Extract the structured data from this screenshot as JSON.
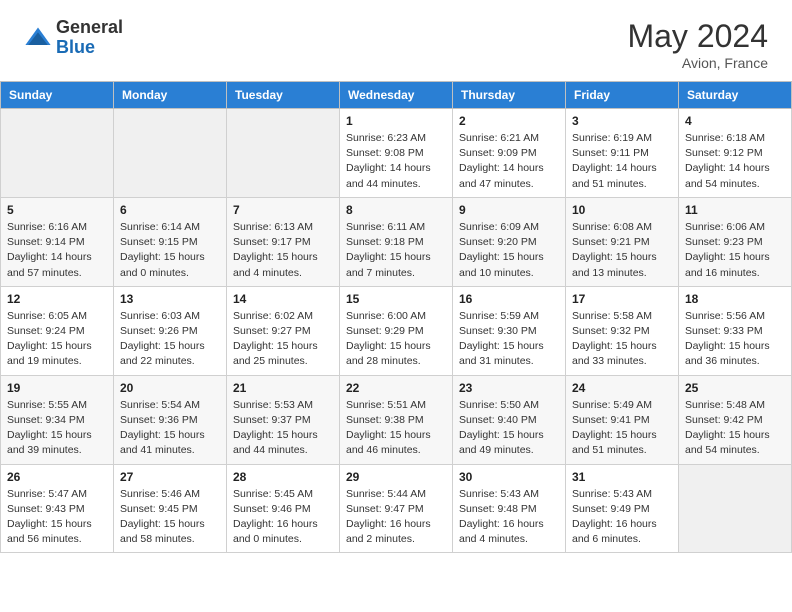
{
  "header": {
    "logo_general": "General",
    "logo_blue": "Blue",
    "month_year": "May 2024",
    "location": "Avion, France"
  },
  "days_of_week": [
    "Sunday",
    "Monday",
    "Tuesday",
    "Wednesday",
    "Thursday",
    "Friday",
    "Saturday"
  ],
  "weeks": [
    [
      {
        "day": "",
        "empty": true
      },
      {
        "day": "",
        "empty": true
      },
      {
        "day": "",
        "empty": true
      },
      {
        "day": "1",
        "sunrise": "Sunrise: 6:23 AM",
        "sunset": "Sunset: 9:08 PM",
        "daylight": "Daylight: 14 hours and 44 minutes."
      },
      {
        "day": "2",
        "sunrise": "Sunrise: 6:21 AM",
        "sunset": "Sunset: 9:09 PM",
        "daylight": "Daylight: 14 hours and 47 minutes."
      },
      {
        "day": "3",
        "sunrise": "Sunrise: 6:19 AM",
        "sunset": "Sunset: 9:11 PM",
        "daylight": "Daylight: 14 hours and 51 minutes."
      },
      {
        "day": "4",
        "sunrise": "Sunrise: 6:18 AM",
        "sunset": "Sunset: 9:12 PM",
        "daylight": "Daylight: 14 hours and 54 minutes."
      }
    ],
    [
      {
        "day": "5",
        "sunrise": "Sunrise: 6:16 AM",
        "sunset": "Sunset: 9:14 PM",
        "daylight": "Daylight: 14 hours and 57 minutes."
      },
      {
        "day": "6",
        "sunrise": "Sunrise: 6:14 AM",
        "sunset": "Sunset: 9:15 PM",
        "daylight": "Daylight: 15 hours and 0 minutes."
      },
      {
        "day": "7",
        "sunrise": "Sunrise: 6:13 AM",
        "sunset": "Sunset: 9:17 PM",
        "daylight": "Daylight: 15 hours and 4 minutes."
      },
      {
        "day": "8",
        "sunrise": "Sunrise: 6:11 AM",
        "sunset": "Sunset: 9:18 PM",
        "daylight": "Daylight: 15 hours and 7 minutes."
      },
      {
        "day": "9",
        "sunrise": "Sunrise: 6:09 AM",
        "sunset": "Sunset: 9:20 PM",
        "daylight": "Daylight: 15 hours and 10 minutes."
      },
      {
        "day": "10",
        "sunrise": "Sunrise: 6:08 AM",
        "sunset": "Sunset: 9:21 PM",
        "daylight": "Daylight: 15 hours and 13 minutes."
      },
      {
        "day": "11",
        "sunrise": "Sunrise: 6:06 AM",
        "sunset": "Sunset: 9:23 PM",
        "daylight": "Daylight: 15 hours and 16 minutes."
      }
    ],
    [
      {
        "day": "12",
        "sunrise": "Sunrise: 6:05 AM",
        "sunset": "Sunset: 9:24 PM",
        "daylight": "Daylight: 15 hours and 19 minutes."
      },
      {
        "day": "13",
        "sunrise": "Sunrise: 6:03 AM",
        "sunset": "Sunset: 9:26 PM",
        "daylight": "Daylight: 15 hours and 22 minutes."
      },
      {
        "day": "14",
        "sunrise": "Sunrise: 6:02 AM",
        "sunset": "Sunset: 9:27 PM",
        "daylight": "Daylight: 15 hours and 25 minutes."
      },
      {
        "day": "15",
        "sunrise": "Sunrise: 6:00 AM",
        "sunset": "Sunset: 9:29 PM",
        "daylight": "Daylight: 15 hours and 28 minutes."
      },
      {
        "day": "16",
        "sunrise": "Sunrise: 5:59 AM",
        "sunset": "Sunset: 9:30 PM",
        "daylight": "Daylight: 15 hours and 31 minutes."
      },
      {
        "day": "17",
        "sunrise": "Sunrise: 5:58 AM",
        "sunset": "Sunset: 9:32 PM",
        "daylight": "Daylight: 15 hours and 33 minutes."
      },
      {
        "day": "18",
        "sunrise": "Sunrise: 5:56 AM",
        "sunset": "Sunset: 9:33 PM",
        "daylight": "Daylight: 15 hours and 36 minutes."
      }
    ],
    [
      {
        "day": "19",
        "sunrise": "Sunrise: 5:55 AM",
        "sunset": "Sunset: 9:34 PM",
        "daylight": "Daylight: 15 hours and 39 minutes."
      },
      {
        "day": "20",
        "sunrise": "Sunrise: 5:54 AM",
        "sunset": "Sunset: 9:36 PM",
        "daylight": "Daylight: 15 hours and 41 minutes."
      },
      {
        "day": "21",
        "sunrise": "Sunrise: 5:53 AM",
        "sunset": "Sunset: 9:37 PM",
        "daylight": "Daylight: 15 hours and 44 minutes."
      },
      {
        "day": "22",
        "sunrise": "Sunrise: 5:51 AM",
        "sunset": "Sunset: 9:38 PM",
        "daylight": "Daylight: 15 hours and 46 minutes."
      },
      {
        "day": "23",
        "sunrise": "Sunrise: 5:50 AM",
        "sunset": "Sunset: 9:40 PM",
        "daylight": "Daylight: 15 hours and 49 minutes."
      },
      {
        "day": "24",
        "sunrise": "Sunrise: 5:49 AM",
        "sunset": "Sunset: 9:41 PM",
        "daylight": "Daylight: 15 hours and 51 minutes."
      },
      {
        "day": "25",
        "sunrise": "Sunrise: 5:48 AM",
        "sunset": "Sunset: 9:42 PM",
        "daylight": "Daylight: 15 hours and 54 minutes."
      }
    ],
    [
      {
        "day": "26",
        "sunrise": "Sunrise: 5:47 AM",
        "sunset": "Sunset: 9:43 PM",
        "daylight": "Daylight: 15 hours and 56 minutes."
      },
      {
        "day": "27",
        "sunrise": "Sunrise: 5:46 AM",
        "sunset": "Sunset: 9:45 PM",
        "daylight": "Daylight: 15 hours and 58 minutes."
      },
      {
        "day": "28",
        "sunrise": "Sunrise: 5:45 AM",
        "sunset": "Sunset: 9:46 PM",
        "daylight": "Daylight: 16 hours and 0 minutes."
      },
      {
        "day": "29",
        "sunrise": "Sunrise: 5:44 AM",
        "sunset": "Sunset: 9:47 PM",
        "daylight": "Daylight: 16 hours and 2 minutes."
      },
      {
        "day": "30",
        "sunrise": "Sunrise: 5:43 AM",
        "sunset": "Sunset: 9:48 PM",
        "daylight": "Daylight: 16 hours and 4 minutes."
      },
      {
        "day": "31",
        "sunrise": "Sunrise: 5:43 AM",
        "sunset": "Sunset: 9:49 PM",
        "daylight": "Daylight: 16 hours and 6 minutes."
      },
      {
        "day": "",
        "empty": true
      }
    ]
  ]
}
